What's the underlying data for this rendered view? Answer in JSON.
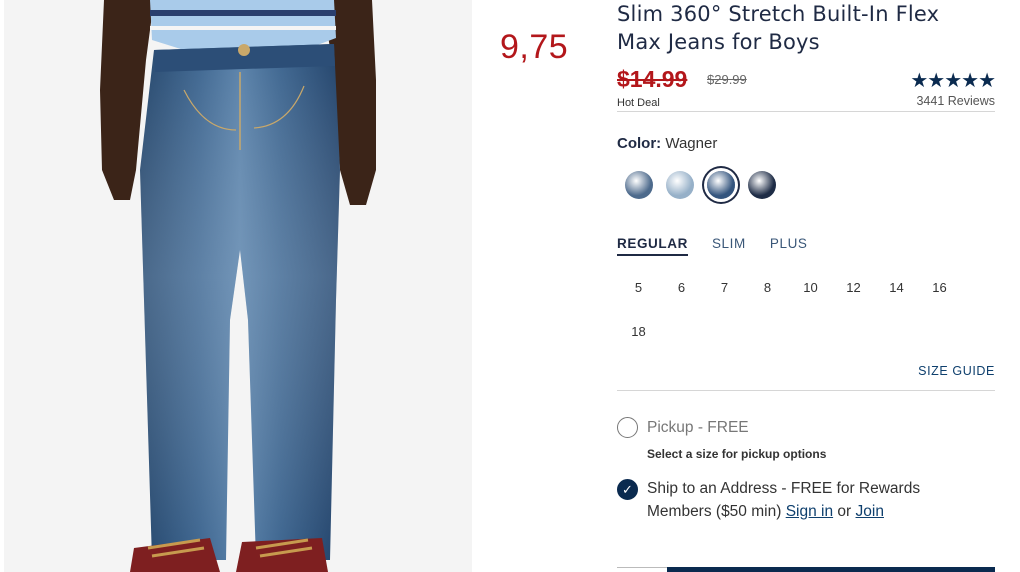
{
  "overlay_price": "9,75",
  "product": {
    "title_line1": "Slim 360° Stretch Built-In Flex",
    "title_line2": "Max Jeans for Boys",
    "sale_price": "$14.99",
    "regular_price": "$29.99",
    "deal_label": "Hot Deal",
    "stars": "★★★★★",
    "reviews": "3441 Reviews"
  },
  "color": {
    "label": "Color:",
    "value": "Wagner",
    "swatches": [
      {
        "name": "medium-wash",
        "color": "#4d6a8c"
      },
      {
        "name": "light-wash",
        "color": "#96b0c8"
      },
      {
        "name": "wagner",
        "color": "#34557e",
        "selected": true
      },
      {
        "name": "dark-rinse",
        "color": "#1e2c46"
      }
    ]
  },
  "fit": {
    "tabs": [
      "REGULAR",
      "SLIM",
      "PLUS"
    ],
    "active": "REGULAR"
  },
  "sizes": [
    "5",
    "6",
    "7",
    "8",
    "10",
    "12",
    "14",
    "16",
    "18"
  ],
  "size_guide": "SIZE GUIDE",
  "fulfillment": {
    "pickup_label": "Pickup - FREE",
    "pickup_sub": "Select a size for pickup options",
    "ship_line1": "Ship to an Address - FREE for Rewards",
    "ship_line2_prefix": "Members ($50 min)",
    "sign_in": "Sign in",
    "or": "or",
    "join": "Join"
  },
  "colors": {
    "sale_red": "#b3171b",
    "navy": "#0a2a4f",
    "link_blue": "#0e3f6d"
  }
}
